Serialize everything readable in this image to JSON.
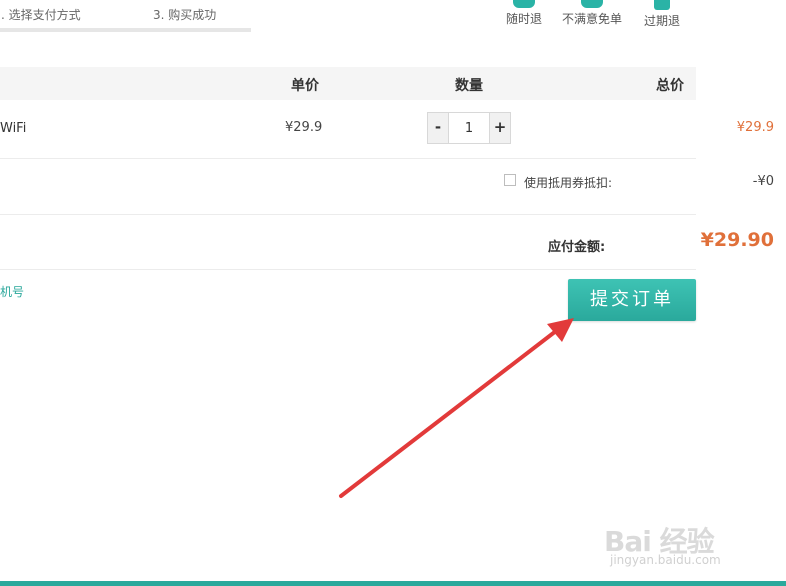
{
  "steps": {
    "step2": ". 选择支付方式",
    "step3": "3. 购买成功"
  },
  "guarantees": [
    {
      "label": "随时退",
      "icon": "shield-icon"
    },
    {
      "label": "不满意免单",
      "icon": "shield-icon"
    },
    {
      "label": "过期退",
      "icon": "clock-icon"
    }
  ],
  "table": {
    "headers": {
      "price": "单价",
      "qty": "数量",
      "total": "总价"
    },
    "item": {
      "name": "WiFi",
      "unit_price": "¥29.9",
      "quantity": "1",
      "total": "¥29.9"
    },
    "minus": "-",
    "plus": "+"
  },
  "coupon": {
    "label": "使用抵用券抵扣:",
    "value": "-¥0"
  },
  "payable": {
    "label": "应付金额:",
    "value": "¥29.90"
  },
  "bind_link": "机号",
  "submit_label": "提交订单",
  "watermark": {
    "brand": "Bai 经验",
    "url": "jingyan.baidu.com"
  },
  "colors": {
    "accent": "#2aa99c",
    "price": "#e0703a",
    "arrow": "#e23a3a"
  }
}
